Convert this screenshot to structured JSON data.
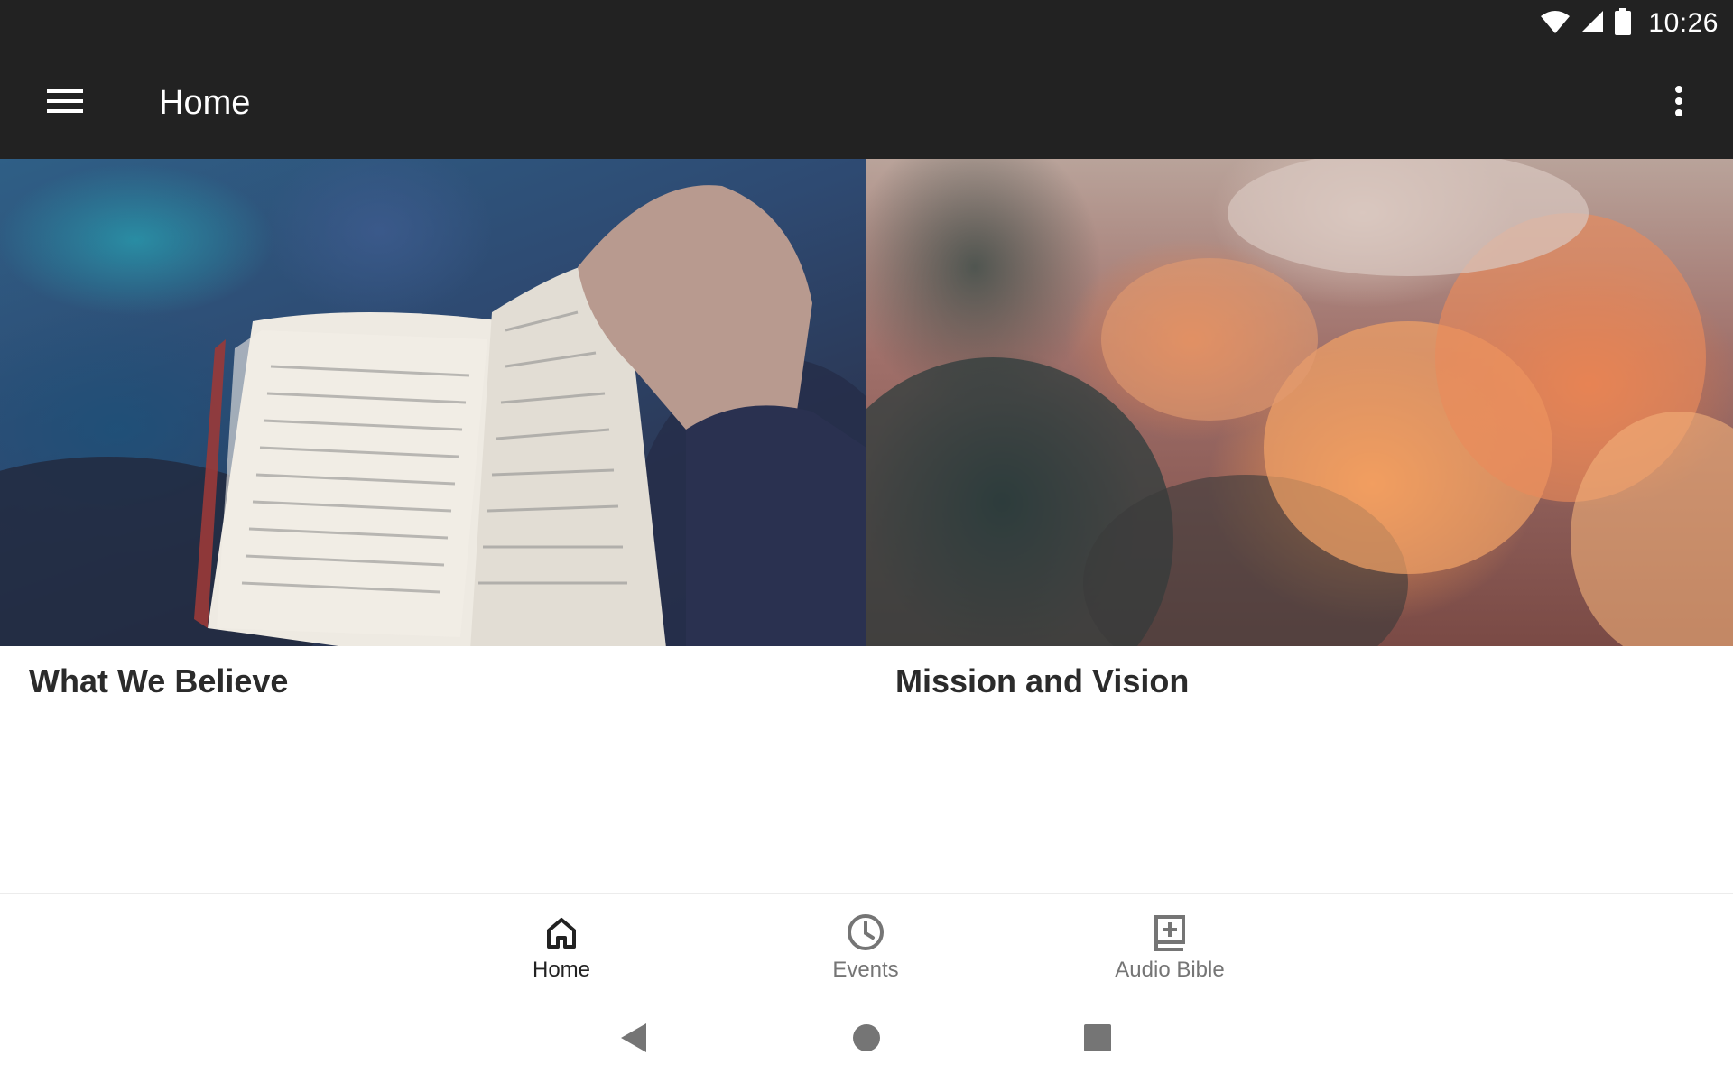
{
  "status_bar": {
    "time": "10:26",
    "icons": [
      "wifi-icon",
      "cell-signal-icon",
      "battery-icon"
    ]
  },
  "app_bar": {
    "title": "Home",
    "menu_icon": "hamburger-menu-icon",
    "overflow_icon": "more-vert-icon"
  },
  "cards": [
    {
      "title": "What We Believe",
      "image": "open-bible-photo"
    },
    {
      "title": "Mission and Vision",
      "image": "sunset-clouds-photo"
    }
  ],
  "bottom_nav": {
    "items": [
      {
        "label": "Home",
        "icon": "home-icon",
        "active": true
      },
      {
        "label": "Events",
        "icon": "clock-icon",
        "active": false
      },
      {
        "label": "Audio Bible",
        "icon": "bible-plus-icon",
        "active": false
      }
    ]
  },
  "system_nav": {
    "icons": [
      "back-icon",
      "home-circle-icon",
      "recents-icon"
    ]
  },
  "colors": {
    "app_bar_bg": "#222222",
    "active_nav": "#222222",
    "inactive_nav": "#757575",
    "title_text": "#2b2b2b"
  }
}
